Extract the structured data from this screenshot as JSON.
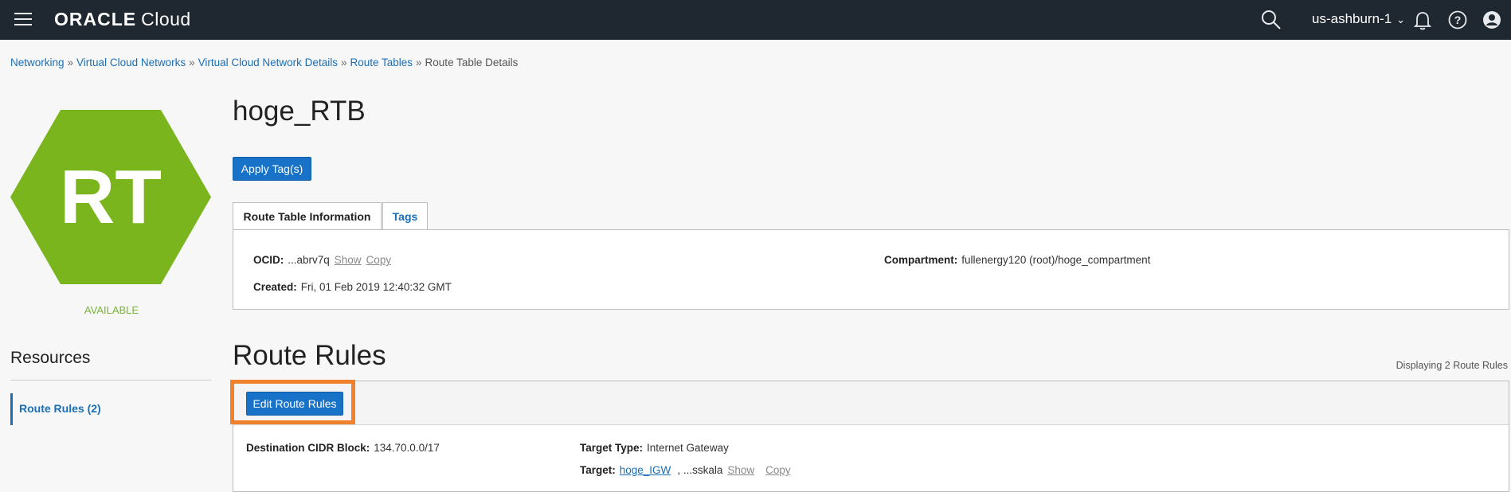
{
  "header": {
    "brand_oracle": "ORACLE",
    "brand_cloud": "Cloud",
    "region": "us-ashburn-1"
  },
  "breadcrumb": [
    "Networking",
    "Virtual Cloud Networks",
    "Virtual Cloud Network Details",
    "Route Tables",
    "Route Table Details"
  ],
  "breadcrumb_separator": "»",
  "resource_icon": {
    "letters": "RT",
    "color": "#7ab51d",
    "status": "AVAILABLE"
  },
  "page_title": "hoge_RTB",
  "apply_tags_label": "Apply Tag(s)",
  "tabs": [
    {
      "label": "Route Table Information",
      "active": true
    },
    {
      "label": "Tags",
      "active": false
    }
  ],
  "info": {
    "ocid_label": "OCID:",
    "ocid_value": "...abrv7q",
    "show_label": "Show",
    "copy_label": "Copy",
    "created_label": "Created:",
    "created_value": "Fri, 01 Feb 2019 12:40:32 GMT",
    "compartment_label": "Compartment:",
    "compartment_value": "fullenergy120 (root)/hoge_compartment"
  },
  "resources": {
    "title": "Resources",
    "items": [
      {
        "label": "Route Rules (2)"
      }
    ]
  },
  "route_rules": {
    "title": "Route Rules",
    "count_text": "Displaying 2 Route Rules",
    "edit_label": "Edit Route Rules",
    "rows": [
      {
        "dest_label": "Destination CIDR Block:",
        "dest_value": "134.70.0.0/17",
        "target_type_label": "Target Type:",
        "target_type_value": "Internet Gateway",
        "target_label": "Target:",
        "target_link": "hoge_IGW",
        "target_ocid": ", ...sskala",
        "show_label": "Show",
        "copy_label": "Copy"
      }
    ]
  },
  "colors": {
    "topbar": "#1f2731",
    "accent": "#1772c8",
    "highlight": "#f0822d",
    "available": "#7ab339"
  }
}
